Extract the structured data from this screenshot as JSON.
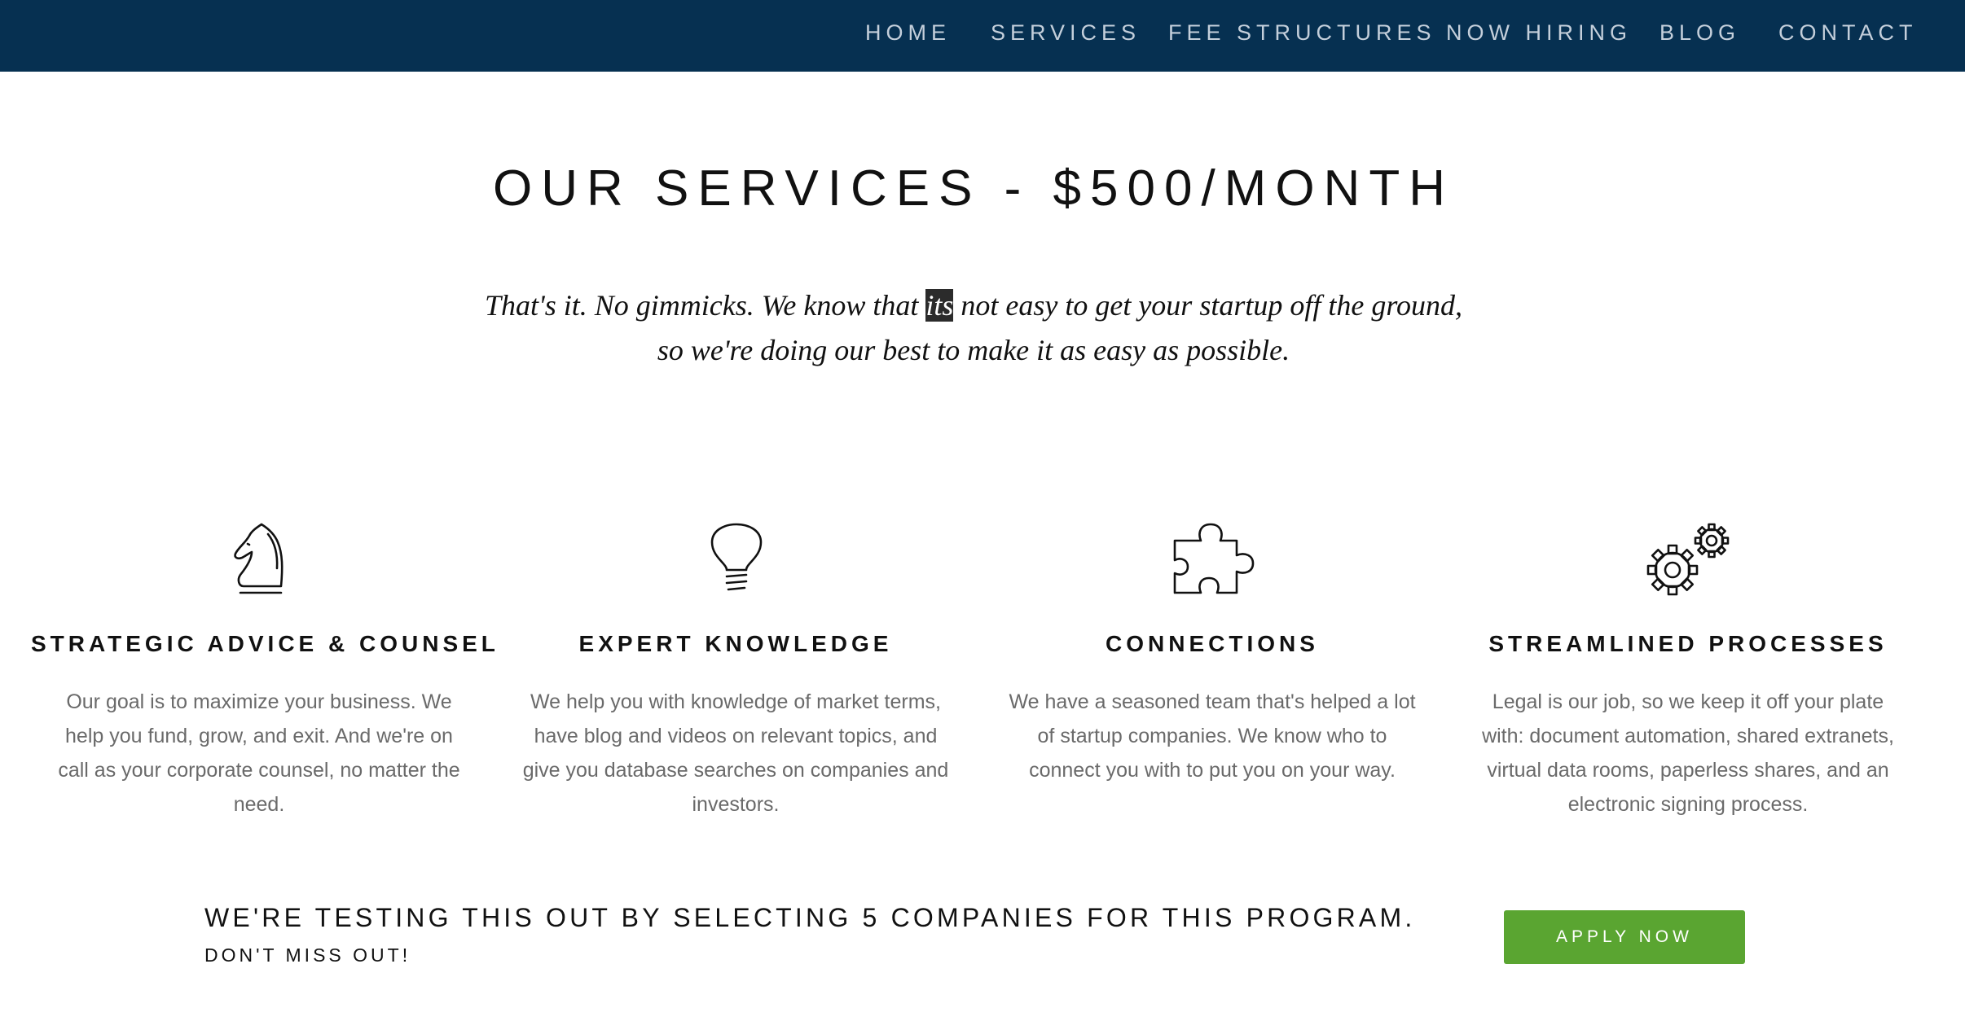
{
  "nav": {
    "items": [
      {
        "label": "HOME"
      },
      {
        "label": "SERVICES"
      },
      {
        "label": "FEE STRUCTURES"
      },
      {
        "label": "NOW HIRING"
      },
      {
        "label": "BLOG"
      },
      {
        "label": "CONTACT"
      }
    ]
  },
  "hero": {
    "title": "OUR SERVICES - $500/MONTH",
    "intro_before": "That's it. No gimmicks. We know that ",
    "intro_highlight": "its",
    "intro_after": " not easy to get your startup off the ground, so we're doing our best to make it as easy as possible."
  },
  "features": [
    {
      "icon": "chess-knight-icon",
      "heading": "STRATEGIC ADVICE & COUNSEL",
      "text": "Our goal is to maximize your business. We help you fund, grow, and exit. And we're on call as your corporate counsel, no matter the need."
    },
    {
      "icon": "lightbulb-icon",
      "heading": "EXPERT KNOWLEDGE",
      "text": "We help you with knowledge of market terms, have blog and videos on relevant topics, and give you database searches on companies and investors."
    },
    {
      "icon": "puzzle-piece-icon",
      "heading": "CONNECTIONS",
      "text": "We have a seasoned team that's helped a lot of startup companies. We know who to connect you with to put you on your way."
    },
    {
      "icon": "gears-icon",
      "heading": "STREAMLINED PROCESSES",
      "text": "Legal is our job, so we keep it off your plate with: document automation, shared extranets, virtual data rooms, paperless shares, and an electronic signing process."
    }
  ],
  "cta": {
    "headline": "WE'RE TESTING THIS OUT BY SELECTING 5 COMPANIES FOR THIS PROGRAM.",
    "subline": "DON'T MISS OUT!",
    "button_label": "APPLY NOW"
  },
  "colors": {
    "navbar": "#063051",
    "button": "#5aa531",
    "body_text": "#6a6a6a"
  }
}
